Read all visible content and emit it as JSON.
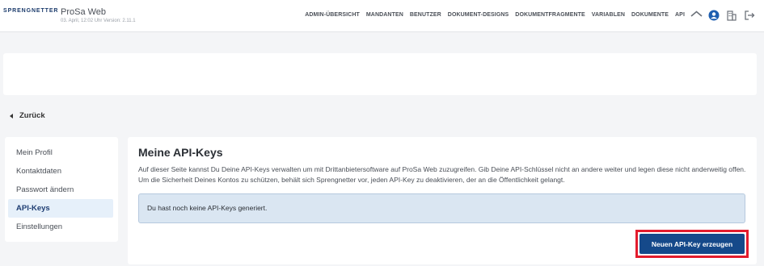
{
  "brand": {
    "logo_text_left": "SPRENGNETTER",
    "app_title": "ProSa Web",
    "app_subtitle": "03. April, 12:02 Uhr Version: 2.11.1"
  },
  "nav": {
    "items": [
      "ADMIN-ÜBERSICHT",
      "MANDANTEN",
      "BENUTZER",
      "DOKUMENT-DESIGNS",
      "DOKUMENTFRAGMENTE",
      "VARIABLEN",
      "DOKUMENTE",
      "API"
    ]
  },
  "header_icons": [
    "home-icon",
    "user-avatar-icon",
    "building-icon",
    "logout-icon"
  ],
  "back": {
    "label": "Zurück"
  },
  "sidebar": {
    "items": [
      {
        "label": "Mein Profil",
        "active": false
      },
      {
        "label": "Kontaktdaten",
        "active": false
      },
      {
        "label": "Passwort ändern",
        "active": false
      },
      {
        "label": "API-Keys",
        "active": true
      },
      {
        "label": "Einstellungen",
        "active": false
      }
    ]
  },
  "main": {
    "title": "Meine API-Keys",
    "description": "Auf dieser Seite kannst Du Deine API-Keys verwalten um mit Drittanbietersoftware auf ProSa Web zuzugreifen. Gib Deine API-Schlüssel nicht an andere weiter und legen diese nicht anderweitig offen. Um die Sicherheit Deines Kontos zu schützen, behält sich Sprengnetter vor, jeden API-Key zu deaktivieren, der an die Öffentlichkeit gelangt.",
    "info_message": "Du hast noch keine API-Keys generiert.",
    "create_button": "Neuen API-Key erzeugen"
  },
  "colors": {
    "primary": "#15498a",
    "highlight": "#e31c2d",
    "info_bg": "#dae6f2",
    "sidebar_active_bg": "#e6f0fa"
  }
}
